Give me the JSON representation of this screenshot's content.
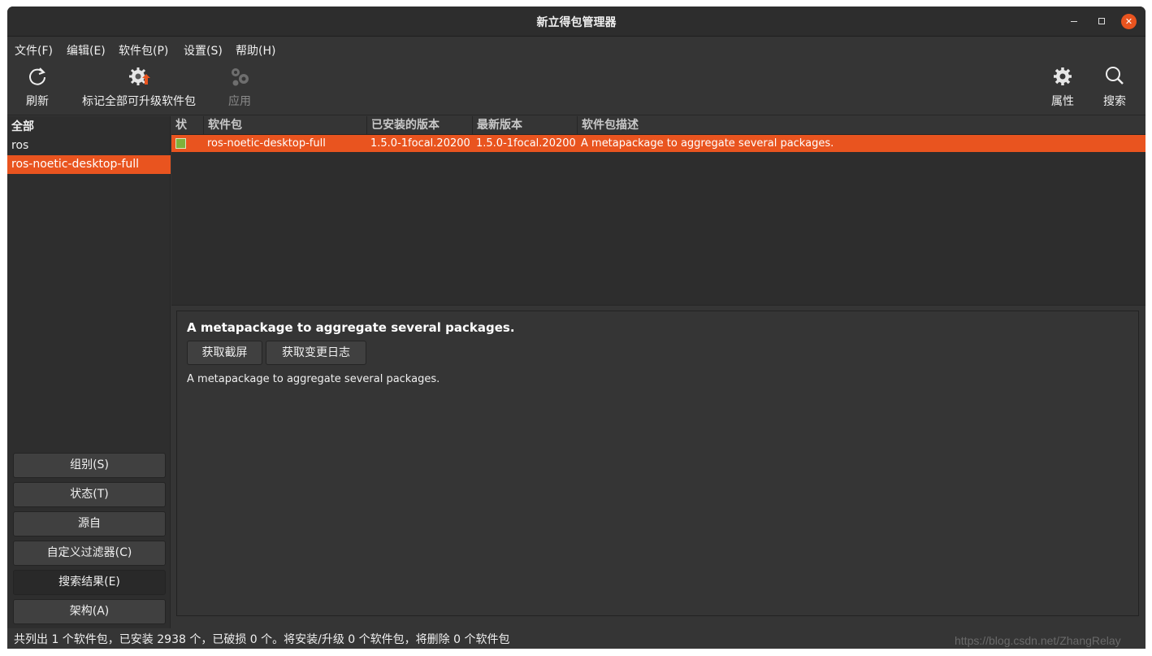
{
  "window": {
    "title": "新立得包管理器"
  },
  "menubar": {
    "items": [
      "文件(F)",
      "编辑(E)",
      "软件包(P)",
      "设置(S)",
      "帮助(H)"
    ]
  },
  "toolbar": {
    "refresh": {
      "label": "刷新",
      "icon": "refresh-icon"
    },
    "mark_all_upgrades": {
      "label": "标记全部可升级软件包",
      "icon": "gear-upgrade-icon"
    },
    "apply": {
      "label": "应用",
      "icon": "gears-icon",
      "disabled": true
    },
    "properties": {
      "label": "属性",
      "icon": "gear-icon"
    },
    "search": {
      "label": "搜索",
      "icon": "search-icon"
    }
  },
  "sidebar": {
    "items": [
      {
        "label": "全部",
        "bold": true
      },
      {
        "label": "ros"
      },
      {
        "label": "ros-noetic-desktop-full",
        "selected": true
      }
    ],
    "filter_buttons": [
      "组别(S)",
      "状态(T)",
      "源自",
      "自定义过滤器(C)",
      "搜索结果(E)",
      "架构(A)"
    ],
    "active_filter": "搜索结果(E)"
  },
  "table": {
    "columns": [
      "状",
      "软件包",
      "已安装的版本",
      "最新版本",
      "软件包描述"
    ],
    "rows": [
      {
        "status": "installed",
        "package": "ros-noetic-desktop-full",
        "installed_version": "1.5.0-1focal.20200",
        "latest_version": "1.5.0-1focal.20200",
        "description": "A metapackage to aggregate several packages."
      }
    ]
  },
  "detail": {
    "title": "A metapackage to aggregate several packages.",
    "screenshot_button": "获取截屏",
    "changelog_button": "获取变更日志",
    "description": "A metapackage to aggregate several packages."
  },
  "statusbar": {
    "text": "共列出 1 个软件包，已安装 2938 个，已破损 0 个。将安装/升级 0 个软件包，将删除 0 个软件包"
  },
  "watermark": "https://blog.csdn.net/ZhangRelay",
  "colors": {
    "accent": "#e9541f",
    "background": "#353535",
    "installed": "#7fb13a"
  }
}
